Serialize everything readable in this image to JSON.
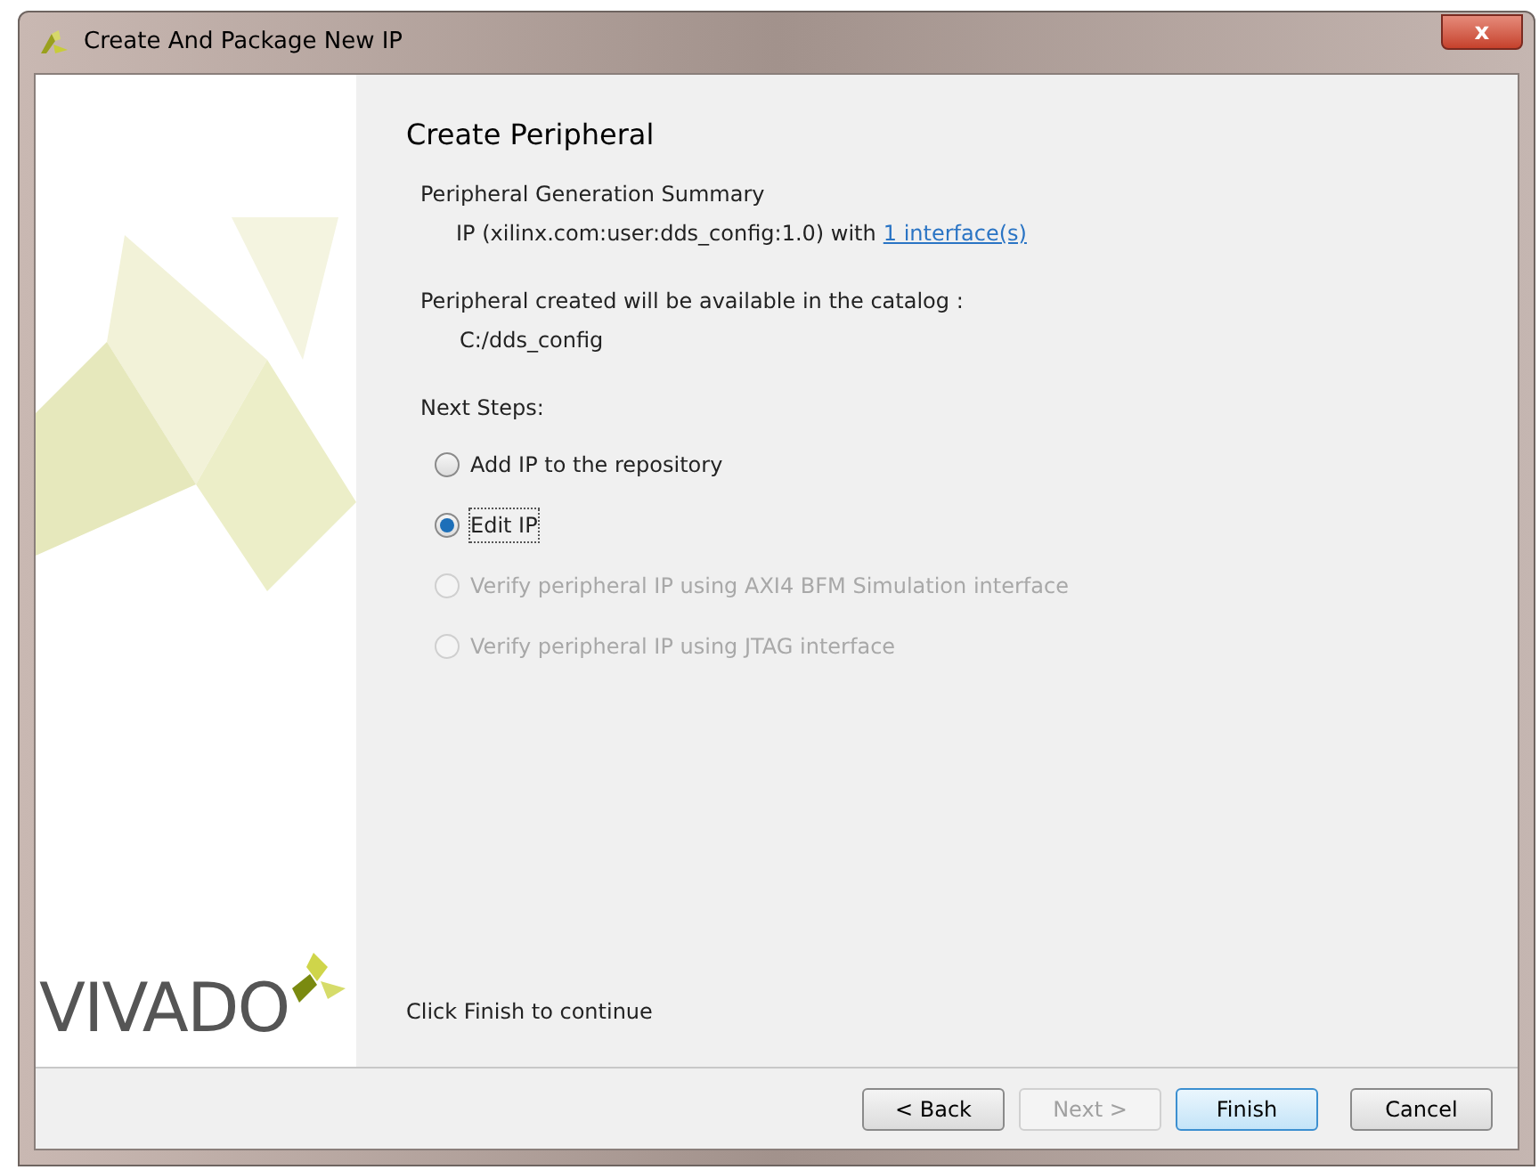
{
  "window": {
    "title": "Create And Package New IP",
    "close": "x"
  },
  "branding": {
    "logo_text": "VIVADO"
  },
  "page": {
    "heading": "Create Peripheral",
    "summary_title": "Peripheral Generation Summary",
    "summary_text": "IP (xilinx.com:user:dds_config:1.0) with",
    "summary_link": "1 interface(s)",
    "catalog_text": "Peripheral created will be available in the catalog :",
    "catalog_path": "C:/dds_config",
    "next_steps_label": "Next Steps:",
    "options": [
      {
        "label": "Add IP to the repository",
        "selected": false,
        "disabled": false
      },
      {
        "label": "Edit IP",
        "selected": true,
        "disabled": false
      },
      {
        "label": "Verify peripheral IP using AXI4 BFM Simulation interface",
        "selected": false,
        "disabled": true
      },
      {
        "label": "Verify peripheral IP using JTAG interface",
        "selected": false,
        "disabled": true
      }
    ],
    "footer_text": "Click Finish to continue"
  },
  "buttons": [
    {
      "label": "< Back",
      "disabled": false,
      "default": false
    },
    {
      "label": "Next >",
      "disabled": true,
      "default": false
    },
    {
      "label": "Finish",
      "disabled": false,
      "default": true
    },
    {
      "label": "Cancel",
      "disabled": false,
      "default": false
    }
  ]
}
